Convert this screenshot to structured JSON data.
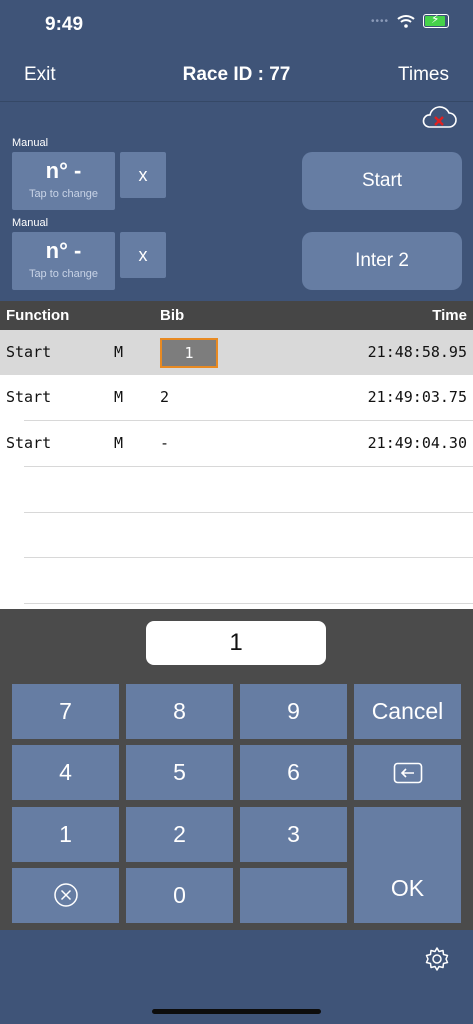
{
  "status_bar": {
    "time": "9:49"
  },
  "nav": {
    "exit": "Exit",
    "title": "Race ID : 77",
    "times": "Times"
  },
  "inputs": [
    {
      "caption": "Manual",
      "value": "n° -",
      "hint": "Tap to change",
      "clear": "x",
      "action": "Start"
    },
    {
      "caption": "Manual",
      "value": "n° -",
      "hint": "Tap to change",
      "clear": "x",
      "action": "Inter 2"
    }
  ],
  "table": {
    "headers": {
      "function": "Function",
      "bib": "Bib",
      "time": "Time"
    },
    "rows": [
      {
        "function": "Start",
        "flag": "M",
        "bib": "1",
        "time": "21:48:58.95"
      },
      {
        "function": "Start",
        "flag": "M",
        "bib": "2",
        "time": "21:49:03.75"
      },
      {
        "function": "Start",
        "flag": "M",
        "bib": "-",
        "time": "21:49:04.30"
      }
    ]
  },
  "keypad": {
    "entry_value": "1",
    "keys": {
      "k7": "7",
      "k8": "8",
      "k9": "9",
      "cancel": "Cancel",
      "k4": "4",
      "k5": "5",
      "k6": "6",
      "k1": "1",
      "k2": "2",
      "k3": "3",
      "k0": "0",
      "ok": "OK"
    }
  },
  "colors": {
    "accent": "#667da3",
    "background": "#3f5478",
    "selected_border": "#e88a22",
    "cloud_error": "#e02020"
  }
}
